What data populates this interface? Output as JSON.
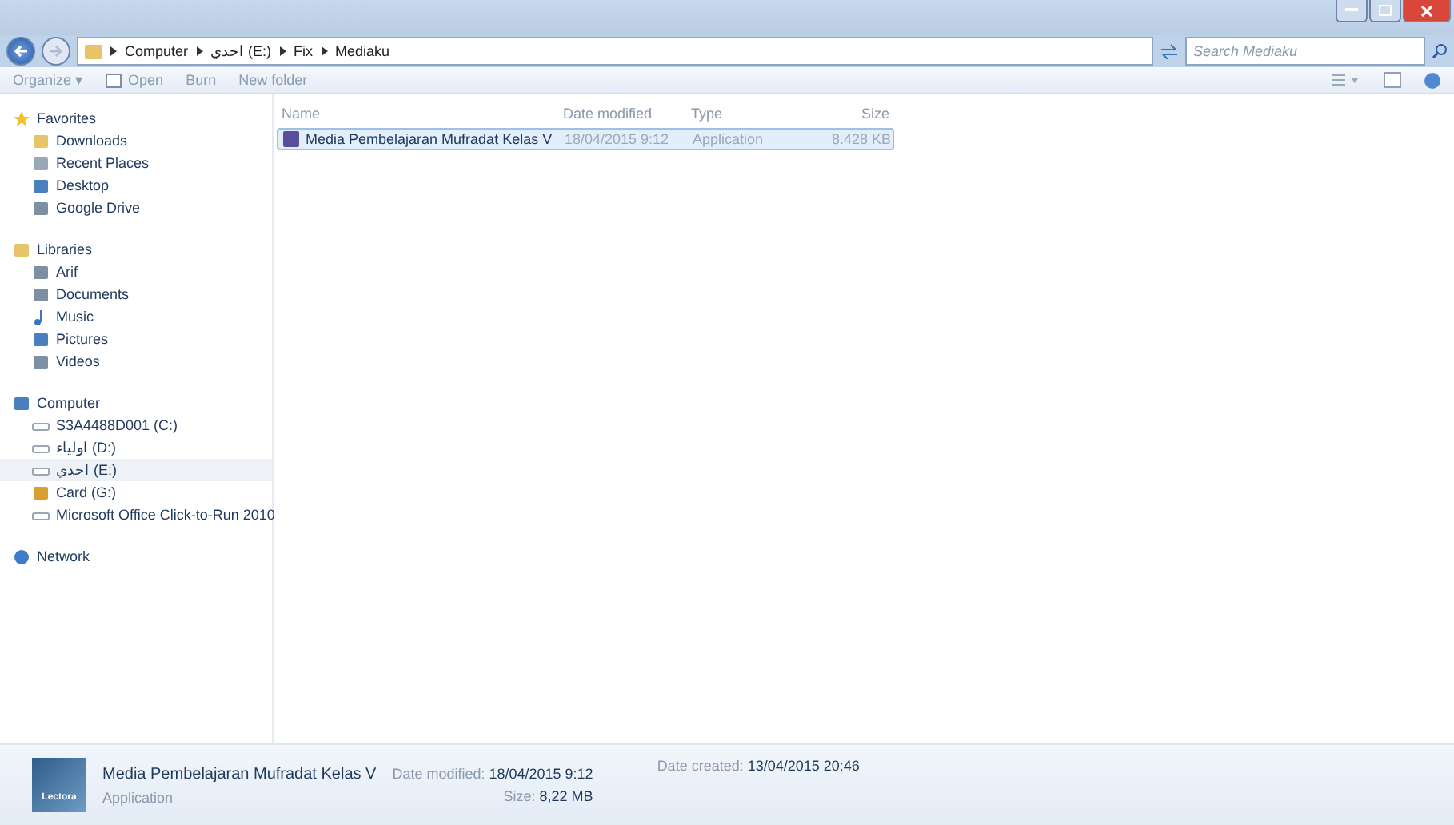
{
  "address": {
    "crumbs": [
      "Computer",
      "احدي (E:)",
      "Fix",
      "Mediaku"
    ]
  },
  "search": {
    "placeholder": "Search Mediaku"
  },
  "toolbar": [
    "Organize ▾",
    "Open",
    "Burn",
    "New folder"
  ],
  "sidebar": {
    "groups": [
      {
        "label": "Favorites",
        "children": [
          {
            "label": "Downloads",
            "selected": false
          },
          {
            "label": "Recent Places",
            "selected": false
          },
          {
            "label": "Desktop",
            "selected": false
          },
          {
            "label": "Google Drive",
            "selected": false
          }
        ]
      },
      {
        "label": "Libraries",
        "children": [
          {
            "label": "Arif",
            "selected": false
          },
          {
            "label": "Documents",
            "selected": false
          },
          {
            "label": "Music",
            "selected": false
          },
          {
            "label": "Pictures",
            "selected": false
          },
          {
            "label": "Videos",
            "selected": false
          }
        ]
      },
      {
        "label": "Computer",
        "children": [
          {
            "label": "S3A4488D001 (C:)",
            "selected": false
          },
          {
            "label": "اولياء (D:)",
            "selected": false
          },
          {
            "label": "احدي (E:)",
            "selected": true
          },
          {
            "label": "Card (G:)",
            "selected": false
          },
          {
            "label": "Microsoft Office Click-to-Run 2010",
            "selected": false
          }
        ]
      },
      {
        "label": "Network"
      }
    ]
  },
  "table": {
    "columns": [
      "Name",
      "Date modified",
      "Type",
      "Size"
    ],
    "rows": [
      {
        "cells": [
          "Media Pembelajaran Mufradat Kelas V",
          "18/04/2015 9:12",
          "Application",
          "8.428 KB"
        ],
        "selected": true
      }
    ]
  },
  "details": {
    "icon_label": "Lectora",
    "name": "Media Pembelajaran Mufradat Kelas V",
    "type": "Application",
    "fields": [
      {
        "label": "Date modified:",
        "value": "18/04/2015 9:12"
      },
      {
        "label": "Size:",
        "value": "8,22 MB"
      },
      {
        "label": "Date created:",
        "value": "13/04/2015 20:46"
      }
    ]
  }
}
